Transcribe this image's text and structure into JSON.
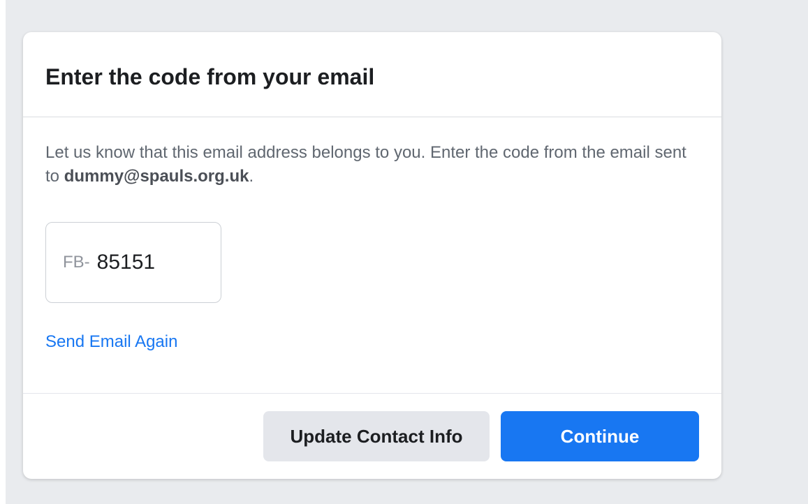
{
  "dialog": {
    "title": "Enter the code from your email",
    "message_prefix": "Let us know that this email address belongs to you. Enter the code from the email sent to ",
    "email": "dummy@spauls.org.uk",
    "message_suffix": ".",
    "code_prefix": "FB-",
    "code_value": "85151",
    "resend_link": "Send Email Again",
    "secondary_button": "Update Contact Info",
    "primary_button": "Continue"
  },
  "colors": {
    "accent": "#1877f2",
    "background": "#e9ebee",
    "secondary_button_bg": "#e4e6eb"
  }
}
